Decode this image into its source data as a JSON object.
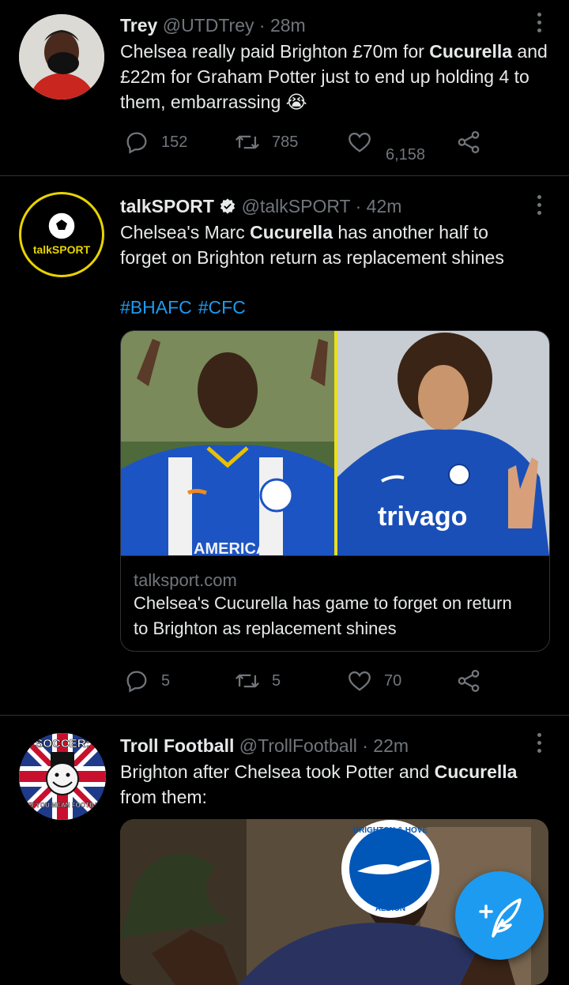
{
  "tweets": [
    {
      "name": "Trey",
      "handle": "@UTDTrey",
      "sep": "·",
      "time": "28m",
      "text": [
        {
          "t": "Chelsea really paid Brighton £70m for ",
          "b": false
        },
        {
          "t": "Cucurella",
          "b": true
        },
        {
          "t": " and £22m for Graham Potter just to end up holding 4 to them, embarrassing ",
          "b": false
        }
      ],
      "emoji": "😭",
      "replies": "152",
      "retweets": "785",
      "likes": "6,158"
    },
    {
      "name": "talkSPORT",
      "handle": "@talkSPORT",
      "sep": "·",
      "time": "42m",
      "avatar_text": "talkSPORT",
      "text": [
        {
          "t": "Chelsea's Marc ",
          "b": false
        },
        {
          "t": "Cucurella",
          "b": true
        },
        {
          "t": " has another half to forget on Brighton return as replacement shines",
          "b": false
        }
      ],
      "hashtags": [
        "#BHAFC",
        "#CFC"
      ],
      "card": {
        "domain": "talksport.com",
        "title": "Chelsea's Cucurella has game to forget on return to Brighton as replacement shines",
        "left_shirt_text": "AMERICAN",
        "right_shirt_text": "trivago"
      },
      "replies": "5",
      "retweets": "5",
      "likes": "70"
    },
    {
      "name": "Troll Football",
      "handle": "@TrollFootball",
      "sep": "·",
      "time": "22m",
      "avatar_top": "SOCCER:",
      "avatar_bottom": "DON'T YOU MEAN FOOTBALL?",
      "text": [
        {
          "t": "Brighton after Chelsea took Potter and ",
          "b": false
        },
        {
          "t": "Cucurella",
          "b": true
        },
        {
          "t": " from them:",
          "b": false
        }
      ],
      "badge_top": "BRIGHTON & HOVE",
      "badge_bottom": "ALBION"
    }
  ],
  "colors": {
    "background": "#000000",
    "accent": "#1d9bf0",
    "muted": "#71767b",
    "divider": "#2f3336"
  },
  "icons": [
    "reply-icon",
    "retweet-icon",
    "like-icon",
    "share-icon",
    "verified-icon",
    "more-icon",
    "compose-icon"
  ]
}
